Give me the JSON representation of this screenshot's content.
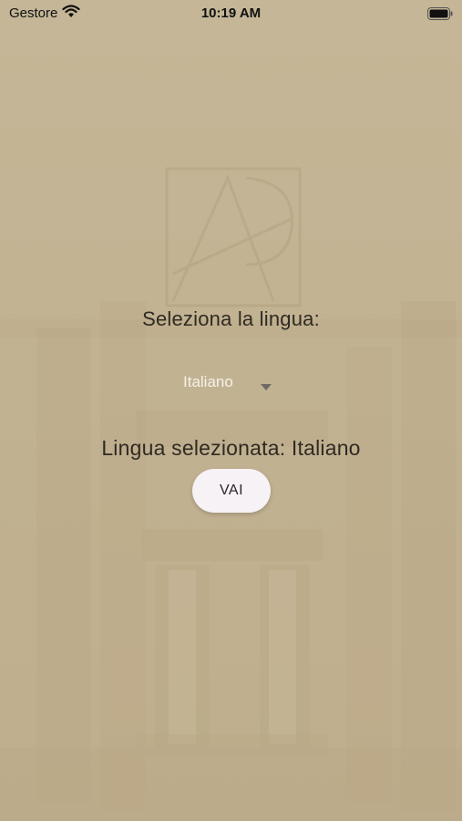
{
  "status_bar": {
    "carrier": "Gestore",
    "time": "10:19 AM",
    "icons": [
      "wifi-icon",
      "battery-icon"
    ]
  },
  "main": {
    "prompt": "Seleziona la lingua:",
    "language_dropdown": {
      "selected": "Italiano",
      "icon": "caret-down-icon"
    },
    "selected_text": "Lingua selezionata: Italiano",
    "go_button_label": "VAI"
  },
  "colors": {
    "background": "#c2b393",
    "text": "#2f2a22",
    "dropdown_text": "#f6f1e7",
    "button_bg": "#f7f2f5"
  },
  "background_image": "temple-ruins-sepia"
}
